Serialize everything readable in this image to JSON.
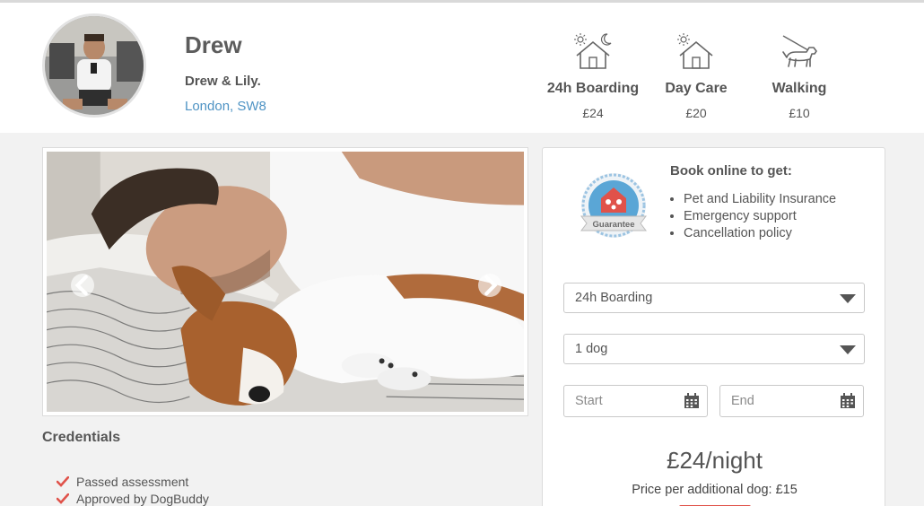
{
  "sitter": {
    "name": "Drew",
    "subtitle": "Drew & Lily.",
    "location": "London, SW8"
  },
  "services": [
    {
      "name": "24h Boarding",
      "price": "£24",
      "icon": "house-sun-moon-icon"
    },
    {
      "name": "Day Care",
      "price": "£20",
      "icon": "house-sun-icon"
    },
    {
      "name": "Walking",
      "price": "£10",
      "icon": "dog-leash-icon"
    }
  ],
  "credentials": {
    "title": "Credentials",
    "items": [
      "Passed assessment",
      "Approved by DogBuddy"
    ]
  },
  "booking": {
    "badge_text": "Guarantee",
    "title": "Book online to get:",
    "benefits": [
      "Pet and Liability Insurance",
      "Emergency support",
      "Cancellation policy"
    ],
    "service_select": "24h Boarding",
    "dogs_select": "1 dog",
    "start_placeholder": "Start",
    "end_placeholder": "End",
    "price": "£24/night",
    "extra_dog": "Price per additional dog: £15"
  },
  "colors": {
    "link": "#4e93c4",
    "check": "#e0524a",
    "badge_blue": "#5aa6d6",
    "badge_red": "#e0524a"
  }
}
